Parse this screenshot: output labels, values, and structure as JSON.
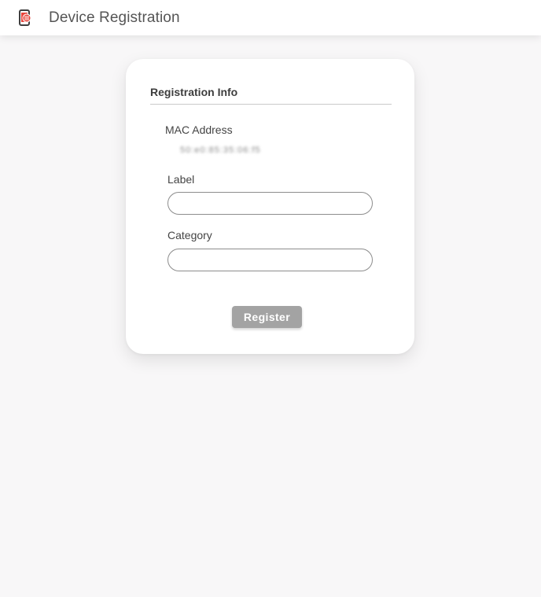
{
  "app": {
    "title": "Device Registration",
    "icon": "device-registration-icon",
    "accent": "#e8443a"
  },
  "form": {
    "section_title": "Registration Info",
    "mac": {
      "label": "MAC Address",
      "value": "50:e0:85:35:06:f5"
    },
    "label_field": {
      "label": "Label",
      "value": "",
      "placeholder": ""
    },
    "category_field": {
      "label": "Category",
      "value": "",
      "placeholder": ""
    },
    "register_label": "Register",
    "register_color": "#a3a3a3"
  }
}
